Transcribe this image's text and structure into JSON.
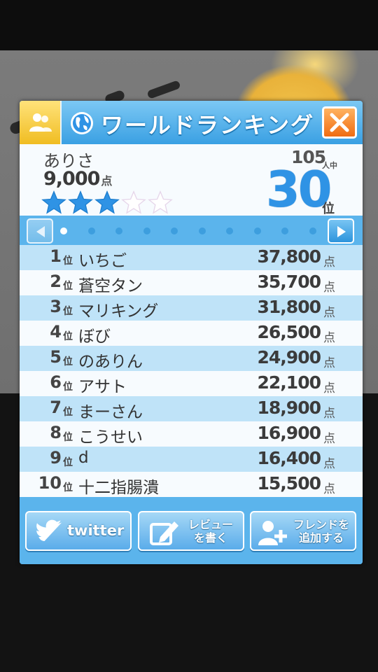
{
  "dialog": {
    "title": "ワールドランキング",
    "icons": {
      "friends_tab": "friends-icon",
      "globe": "globe-icon",
      "close": "close-icon"
    }
  },
  "me": {
    "name": "ありさ",
    "score": "9,000",
    "score_unit": "点",
    "stars_filled": 3,
    "stars_total": 5,
    "total_players": "105",
    "total_unit": "人中",
    "rank": "30",
    "rank_unit": "位"
  },
  "pager": {
    "page_count": 10,
    "current_page": 1,
    "prev_icon": "left-arrow-icon",
    "next_icon": "right-arrow-icon"
  },
  "ranking": [
    {
      "rank": "1",
      "rank_unit": "位",
      "name": "いちご",
      "score": "37,800",
      "score_unit": "点"
    },
    {
      "rank": "2",
      "rank_unit": "位",
      "name": "蒼空タン",
      "score": "35,700",
      "score_unit": "点"
    },
    {
      "rank": "3",
      "rank_unit": "位",
      "name": "マリキング",
      "score": "31,800",
      "score_unit": "点"
    },
    {
      "rank": "4",
      "rank_unit": "位",
      "name": "ぼび",
      "score": "26,500",
      "score_unit": "点"
    },
    {
      "rank": "5",
      "rank_unit": "位",
      "name": "のありん",
      "score": "24,900",
      "score_unit": "点"
    },
    {
      "rank": "6",
      "rank_unit": "位",
      "name": "アサト",
      "score": "22,100",
      "score_unit": "点"
    },
    {
      "rank": "7",
      "rank_unit": "位",
      "name": "まーさん",
      "score": "18,900",
      "score_unit": "点"
    },
    {
      "rank": "8",
      "rank_unit": "位",
      "name": "こうせい",
      "score": "16,900",
      "score_unit": "点"
    },
    {
      "rank": "9",
      "rank_unit": "位",
      "name": "d",
      "score": "16,400",
      "score_unit": "点"
    },
    {
      "rank": "10",
      "rank_unit": "位",
      "name": "十二指腸潰",
      "score": "15,500",
      "score_unit": "点"
    }
  ],
  "footer": {
    "twitter_label": "twitter",
    "review_label_1": "レビュー",
    "review_label_2": "を書く",
    "friend_label_1": "フレンドを",
    "friend_label_2": "追加する",
    "icons": {
      "twitter": "twitter-bird-icon",
      "review": "pencil-note-icon",
      "friend": "add-friend-icon"
    }
  },
  "colors": {
    "accent": "#5bb4ec",
    "rank_blue": "#2f93e5",
    "close": "#f06c12",
    "tab": "#f0bd22"
  }
}
